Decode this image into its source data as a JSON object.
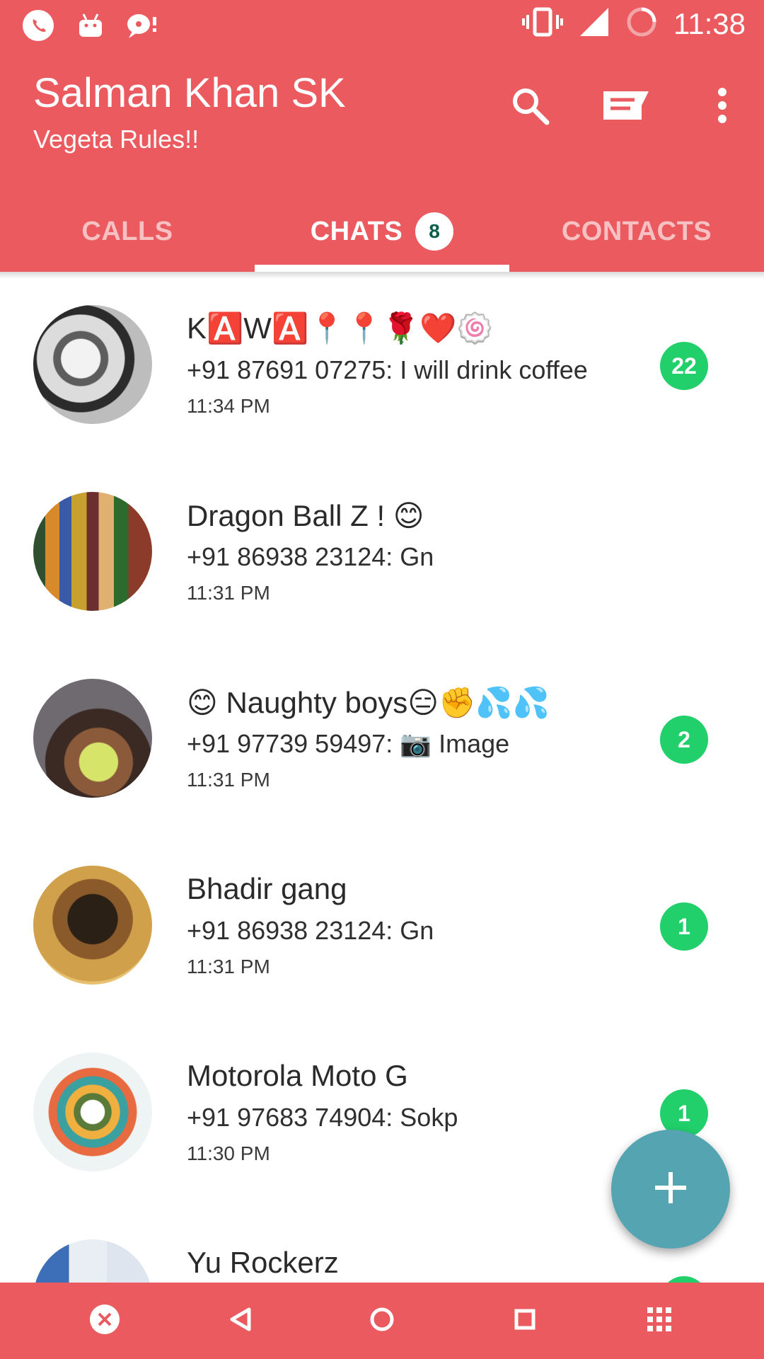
{
  "status_bar": {
    "time": "11:38",
    "left_icons": [
      "whatsapp-icon",
      "android-icon",
      "chat-bubble-icon"
    ],
    "right_icons": [
      "vibrate-icon",
      "signal-icon",
      "battery-ring-icon"
    ]
  },
  "header": {
    "title": "Salman Khan SK",
    "subtitle": "Vegeta Rules!!",
    "actions": [
      "search-icon",
      "message-icon",
      "overflow-menu-icon"
    ]
  },
  "tabs": [
    {
      "label": "CALLS",
      "active": false
    },
    {
      "label": "CHATS",
      "active": true,
      "badge": "8"
    },
    {
      "label": "CONTACTS",
      "active": false
    }
  ],
  "chats": [
    {
      "name": "K🅰️W🅰️📍📍🌹❤️🍥",
      "message": "+91 87691 07275: I will drink coffee",
      "time": "11:34 PM",
      "unread": "22"
    },
    {
      "name": "Dragon Ball Z ! 😊",
      "message": "+91 86938 23124: Gn",
      "time": "11:31 PM",
      "unread": ""
    },
    {
      "name": "😊 Naughty boys😑✊💦💦",
      "message": "+91 97739 59497: 📷 Image",
      "time": "11:31 PM",
      "unread": "2"
    },
    {
      "name": "Bhadir gang",
      "message": "+91 86938 23124: Gn",
      "time": "11:31 PM",
      "unread": "1"
    },
    {
      "name": "Motorola Moto G",
      "message": "+91 97683 74904: Sokp",
      "time": "11:30 PM",
      "unread": "1"
    },
    {
      "name": "Yu Rockerz",
      "message": "",
      "time": "",
      "unread": ""
    }
  ],
  "fab": {
    "icon": "plus-icon"
  },
  "nav": [
    "close-circle-icon",
    "back-icon",
    "home-icon",
    "recents-icon",
    "apps-grid-icon"
  ],
  "colors": {
    "accent": "#EA5A5F",
    "unread_badge": "#21D06A",
    "fab": "#55A4B1"
  }
}
